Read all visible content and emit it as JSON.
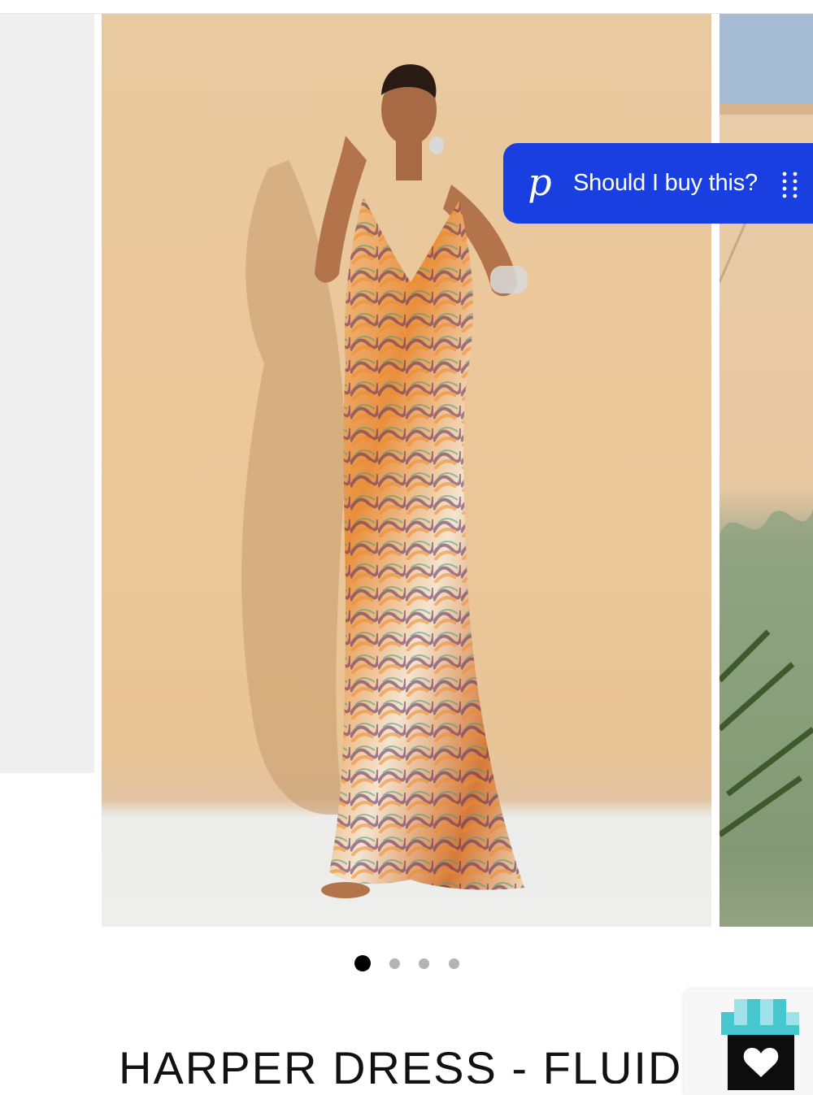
{
  "assistant": {
    "logo": "p",
    "prompt": "Should I buy this?"
  },
  "gallery": {
    "slide_count": 4,
    "active_index": 0
  },
  "product": {
    "title": "HARPER DRESS - FLUID"
  },
  "colors": {
    "assistant_bg": "#1a3fe0",
    "dot_active": "#000000",
    "dot_inactive": "#b3b3b3",
    "wishlist_accent": "#46c6cf"
  },
  "icons": {
    "zoom": "magnifier-icon",
    "drag": "drag-handle-icon",
    "wishlist": "heart-icon"
  }
}
